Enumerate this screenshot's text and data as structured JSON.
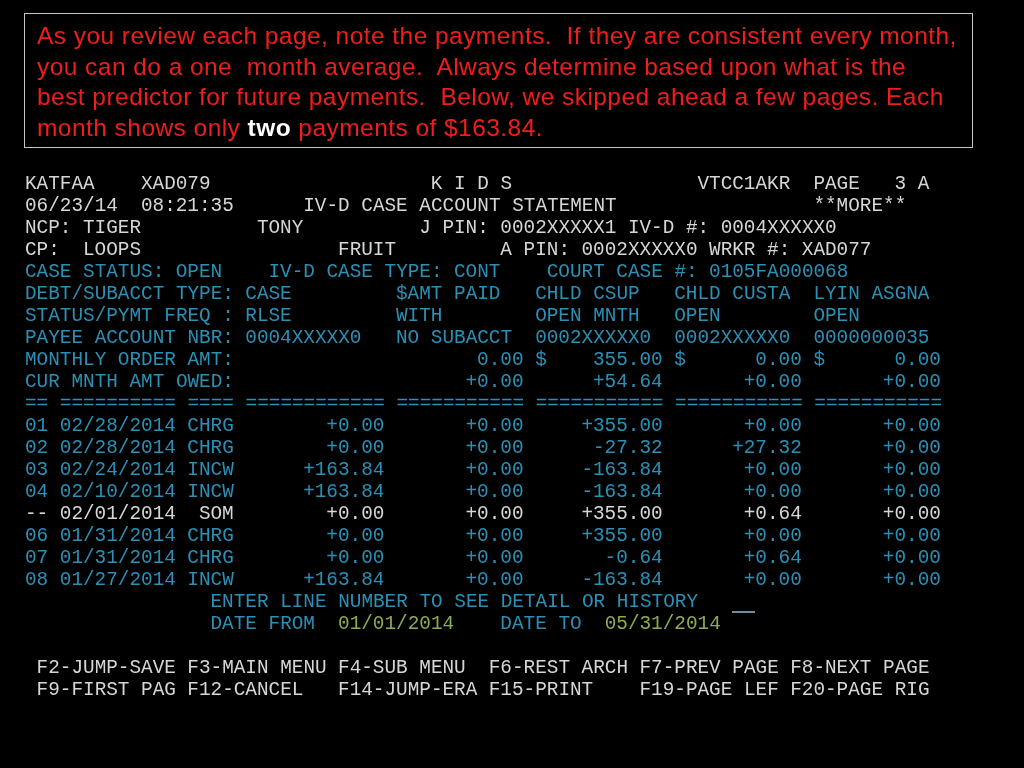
{
  "note": {
    "text": "As you review each page, note the payments.  If they are consistent every month,\nyou can do a one  month average.  Always determine based upon what is the\nbest predictor for future payments.  Below, we skipped ahead a few pages. Each\nmonth shows only **two** payments of $163.84."
  },
  "screen": {
    "header": {
      "session_id": "KATFAA",
      "operator_id": "XAD079",
      "system_name": "K I D S",
      "terminal_id": "VTCC1AKR",
      "page_label": "PAGE",
      "page": "3 A",
      "date": "06/23/14",
      "time": "08:21:35",
      "title": "IV-D CASE ACCOUNT STATEMENT",
      "more_indicator": "**MORE**"
    },
    "parties": [
      {
        "role": "NCP:",
        "last_name": "TIGER",
        "first_name": "TONY",
        "pin_label": "J PIN:",
        "pin": "0002XXXXX1",
        "id_label": "IV-D #:",
        "id": "0004XXXXX0"
      },
      {
        "role": "CP:",
        "last_name": "LOOPS",
        "first_name": "FRUIT",
        "pin_label": "A PIN:",
        "pin": "0002XXXXX0",
        "id_label": "WRKR #:",
        "id": "XAD077"
      }
    ],
    "case_fields": [
      {
        "label": "CASE STATUS:",
        "value": "OPEN"
      },
      {
        "label": "IV-D CASE TYPE:",
        "value": "CONT"
      },
      {
        "label": "COURT CASE #:",
        "value": "0105FA000068"
      }
    ],
    "summary_rows": [
      {
        "kind": "text",
        "label": "DEBT/SUBACCT TYPE:",
        "case_value": "CASE",
        "values": [
          "$AMT PAID",
          "CHLD CSUP",
          "CHLD CUSTA",
          "LYIN ASGNA"
        ]
      },
      {
        "kind": "text",
        "label": "STATUS/PYMT FREQ :",
        "case_value": "RLSE",
        "values": [
          "WITH",
          "OPEN MNTH",
          "OPEN",
          "OPEN"
        ]
      },
      {
        "kind": "text",
        "label": "PAYEE ACCOUNT NBR:",
        "case_value": "0004XXXXX0",
        "values": [
          "NO SUBACCT",
          "0002XXXXX0",
          "0002XXXXX0",
          "0000000035"
        ]
      },
      {
        "kind": "amount",
        "label": "MONTHLY ORDER AMT:",
        "values": [
          {
            "amount": "0.00"
          },
          {
            "currency": "$",
            "amount": "355.00"
          },
          {
            "currency": "$",
            "amount": "0.00"
          },
          {
            "currency": "$",
            "amount": "0.00"
          }
        ]
      },
      {
        "kind": "amount",
        "label": "CUR MNTH AMT OWED:",
        "values": [
          {
            "amount": "+0.00"
          },
          {
            "amount": "+54.64"
          },
          {
            "amount": "+0.00"
          },
          {
            "amount": "+0.00"
          }
        ]
      }
    ],
    "transactions": {
      "separator": "== ========== ==== ============ =========== =========== =========== ===========",
      "rows": [
        {
          "kind": "detail",
          "line": "01",
          "date": "02/28/2014",
          "type": "CHRG",
          "amounts": [
            "+0.00",
            "+0.00",
            "+355.00",
            "+0.00",
            "+0.00"
          ]
        },
        {
          "kind": "detail",
          "line": "02",
          "date": "02/28/2014",
          "type": "CHRG",
          "amounts": [
            "+0.00",
            "+0.00",
            "-27.32",
            "+27.32",
            "+0.00"
          ]
        },
        {
          "kind": "detail",
          "line": "03",
          "date": "02/24/2014",
          "type": "INCW",
          "amounts": [
            "+163.84",
            "+0.00",
            "-163.84",
            "+0.00",
            "+0.00"
          ]
        },
        {
          "kind": "detail",
          "line": "04",
          "date": "02/10/2014",
          "type": "INCW",
          "amounts": [
            "+163.84",
            "+0.00",
            "-163.84",
            "+0.00",
            "+0.00"
          ]
        },
        {
          "kind": "summary",
          "line": "--",
          "date": "02/01/2014",
          "type": "SOM",
          "amounts": [
            "+0.00",
            "+0.00",
            "+355.00",
            "+0.64",
            "+0.00"
          ]
        },
        {
          "kind": "detail",
          "line": "06",
          "date": "01/31/2014",
          "type": "CHRG",
          "amounts": [
            "+0.00",
            "+0.00",
            "+355.00",
            "+0.00",
            "+0.00"
          ]
        },
        {
          "kind": "detail",
          "line": "07",
          "date": "01/31/2014",
          "type": "CHRG",
          "amounts": [
            "+0.00",
            "+0.00",
            "-0.64",
            "+0.64",
            "+0.00"
          ]
        },
        {
          "kind": "detail",
          "line": "08",
          "date": "01/27/2014",
          "type": "INCW",
          "amounts": [
            "+163.84",
            "+0.00",
            "-163.84",
            "+0.00",
            "+0.00"
          ]
        }
      ]
    },
    "prompt": {
      "text": "ENTER LINE NUMBER TO SEE DETAIL OR HISTORY"
    },
    "date_range": {
      "from_label": "DATE FROM",
      "from": "01/01/2014",
      "to_label": "DATE TO",
      "to": "05/31/2014"
    },
    "function_keys": [
      [
        "F2-JUMP-SAVE",
        "F3-MAIN MENU",
        "F4-SUB MENU",
        "F6-REST ARCH",
        "F7-PREV PAGE",
        "F8-NEXT PAGE"
      ],
      [
        "F9-FIRST PAG",
        "F12-CANCEL",
        "F14-JUMP-ERA",
        "F15-PRINT",
        "F19-PAGE LEF",
        "F20-PAGE RIG"
      ]
    ]
  }
}
